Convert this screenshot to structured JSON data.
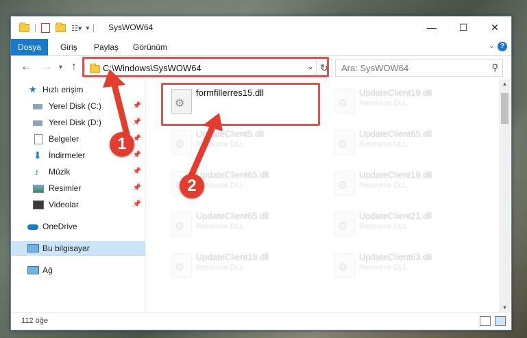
{
  "window": {
    "title": "SysWOW64",
    "controls": {
      "minimize": "—",
      "maximize": "☐",
      "close": "✕"
    }
  },
  "ribbon": {
    "tabs": [
      "Dosya",
      "Giriş",
      "Paylaş",
      "Görünüm"
    ],
    "active_tab": "Dosya",
    "accent": "#1979ca"
  },
  "nav": {
    "address": "C:\\Windows\\SysWOW64",
    "search_placeholder": "Ara: SysWOW64"
  },
  "sidebar": {
    "items": [
      {
        "label": "Hızlı erişim",
        "icon": "star-icon",
        "pinned": false
      },
      {
        "label": "Yerel Disk (C:)",
        "icon": "drive-icon",
        "pinned": true
      },
      {
        "label": "Yerel Disk (D:)",
        "icon": "drive-icon",
        "pinned": true
      },
      {
        "label": "Belgeler",
        "icon": "documents-icon",
        "pinned": true
      },
      {
        "label": "İndirmeler",
        "icon": "download-icon",
        "pinned": true
      },
      {
        "label": "Müzik",
        "icon": "music-icon",
        "pinned": true
      },
      {
        "label": "Resimler",
        "icon": "pictures-icon",
        "pinned": true
      },
      {
        "label": "Videolar",
        "icon": "videos-icon",
        "pinned": true
      },
      {
        "label": "OneDrive",
        "icon": "cloud-icon",
        "pinned": false
      },
      {
        "label": "Bu bilgisayar",
        "icon": "computer-icon",
        "pinned": false,
        "selected": true
      },
      {
        "label": "Ağ",
        "icon": "network-icon",
        "pinned": false
      }
    ]
  },
  "files": [
    {
      "name": "formfillerres15.dll",
      "type": "",
      "highlighted": true
    },
    {
      "name": "UpdateClient19.dll",
      "type": "Resource DLL"
    },
    {
      "name": "UpdateClient5.dll",
      "type": "Resource DLL"
    },
    {
      "name": "UpdateClient65.dll",
      "type": "Resource DLL"
    },
    {
      "name": "UpdateClient65.dll",
      "type": "Resource DLL"
    },
    {
      "name": "UpdateClient19.dll",
      "type": "Resource DLL"
    },
    {
      "name": "UpdateClient65.dll",
      "type": "Resource DLL"
    },
    {
      "name": "UpdateClient21.dll",
      "type": "Resource DLL"
    },
    {
      "name": "UpdateClient19.dll",
      "type": "Resource DLL"
    },
    {
      "name": "UpdateClient63.dll",
      "type": "Resource DLL"
    }
  ],
  "status": {
    "item_count": "112 öğe"
  },
  "annotations": {
    "badge1": "1",
    "badge2": "2",
    "color": "#e23d2e"
  }
}
